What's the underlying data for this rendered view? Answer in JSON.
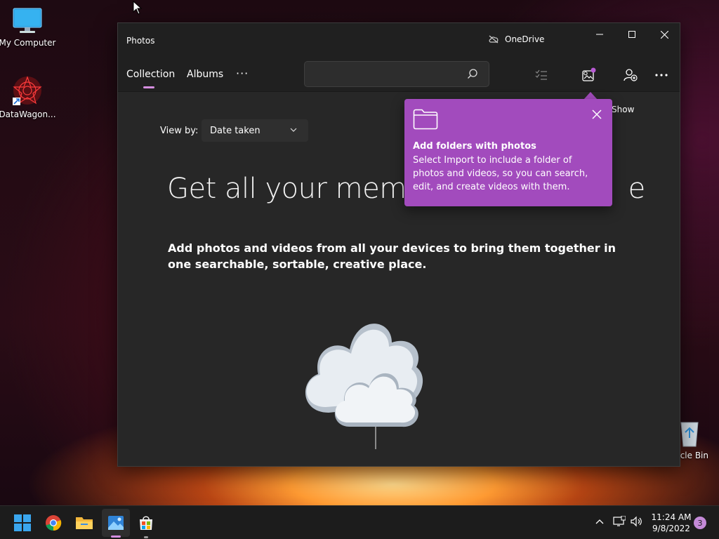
{
  "desktop": {
    "icons": [
      {
        "label": "My Computer"
      },
      {
        "label": "DataWagon..."
      },
      {
        "label": "cycle Bin"
      }
    ]
  },
  "window": {
    "title": "Photos",
    "onedrive_label": "OneDrive",
    "tabs": [
      {
        "label": "Collection",
        "selected": true
      },
      {
        "label": "Albums",
        "selected": false
      }
    ],
    "more_label": "···",
    "search": {
      "value": "",
      "placeholder": ""
    },
    "toolbar": {
      "select_icon": "select-list-icon",
      "import_icon": "import-photo-icon",
      "people_icon": "add-person-icon",
      "more_icon": "more-icon"
    },
    "show_text": "Show"
  },
  "content": {
    "view_by_label": "View by:",
    "view_by_value": "Date taken",
    "hero_title": "Get all your memo",
    "hero_title_tail": "e",
    "subtitle": "Add photos and videos from all your devices to bring them together in one searchable, sortable, creative place."
  },
  "teaching_tip": {
    "title": "Add folders with photos",
    "body": "Select Import to include a folder of photos and videos, so you can search, edit, and create videos with them."
  },
  "taskbar": {
    "apps": [
      "start",
      "chrome",
      "file-explorer",
      "photos",
      "microsoft-store"
    ],
    "time": "11:24 AM",
    "date": "9/8/2022",
    "notification_count": "3"
  },
  "colors": {
    "accent": "#a24bbd",
    "indicator": "#d58ee0",
    "window_bg": "#272727",
    "titlebar_bg": "#202020"
  }
}
